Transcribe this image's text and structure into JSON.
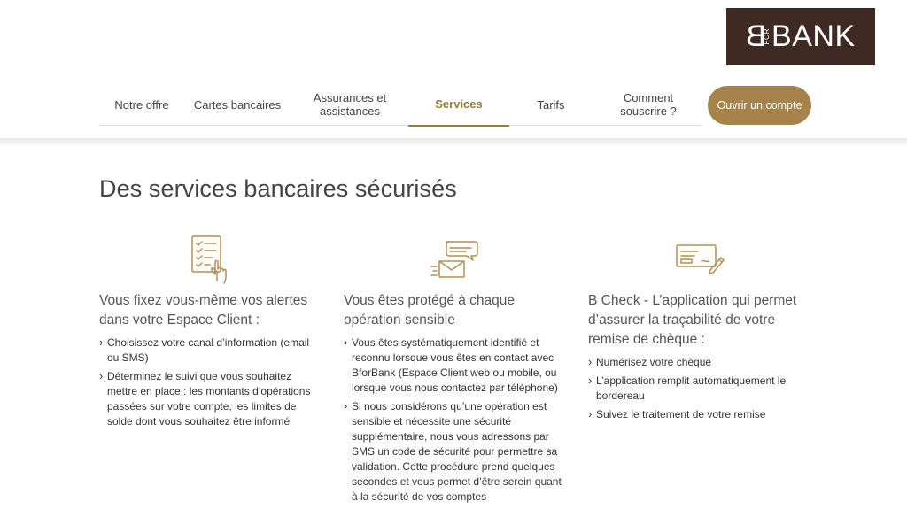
{
  "brand": {
    "logo_left": "B",
    "logo_mid": "FOR",
    "logo_right": "BANK",
    "logo_bg": "#3e2a23",
    "accent": "#a5834b"
  },
  "nav": {
    "items": [
      {
        "label": "Notre offre"
      },
      {
        "label": "Cartes bancaires"
      },
      {
        "label": "Assurances et assistances"
      },
      {
        "label": "Services"
      },
      {
        "label": "Tarifs"
      },
      {
        "label": "Comment souscrire ?"
      }
    ],
    "active": "Services",
    "cta_label": "Ouvrir un compte"
  },
  "main": {
    "title": "Des services bancaires sécurisés",
    "columns": [
      {
        "icon": "checklist-hand-icon",
        "heading": "Vous fixez vous-même vos alertes dans votre Espace Client :",
        "items": [
          "Choisissez votre canal d’information (email ou SMS)",
          "Déterminez le suivi que vous souhaitez mettre en place : les montants d’opérations passées sur votre compte, les limites de solde dont vous souhaitez être informé"
        ]
      },
      {
        "icon": "envelope-message-icon",
        "heading": "Vous êtes protégé à chaque opération sensible",
        "items": [
          "Vous êtes systématiquement identifié et reconnu lorsque vous êtes en contact avec BforBank (Espace Client web ou mobile, ou lorsque vous nous contactez par téléphone)",
          "Si nous considérons qu’une opération est sensible et nécessite une sécurité supplémentaire, nous vous adressons par SMS un code de sécurité pour permettre sa validation. Cette procédure prend quelques secondes et vous permet d’être serein quant à la sécurité de vos comptes"
        ]
      },
      {
        "icon": "cheque-pen-icon",
        "heading": "B Check - L’application qui permet d’assurer la traçabilité de votre remise de chèque :",
        "items": [
          "Numérisez votre chèque",
          "L’application remplit automatiquement le bordereau",
          "Suivez le traitement de votre remise"
        ]
      }
    ]
  }
}
